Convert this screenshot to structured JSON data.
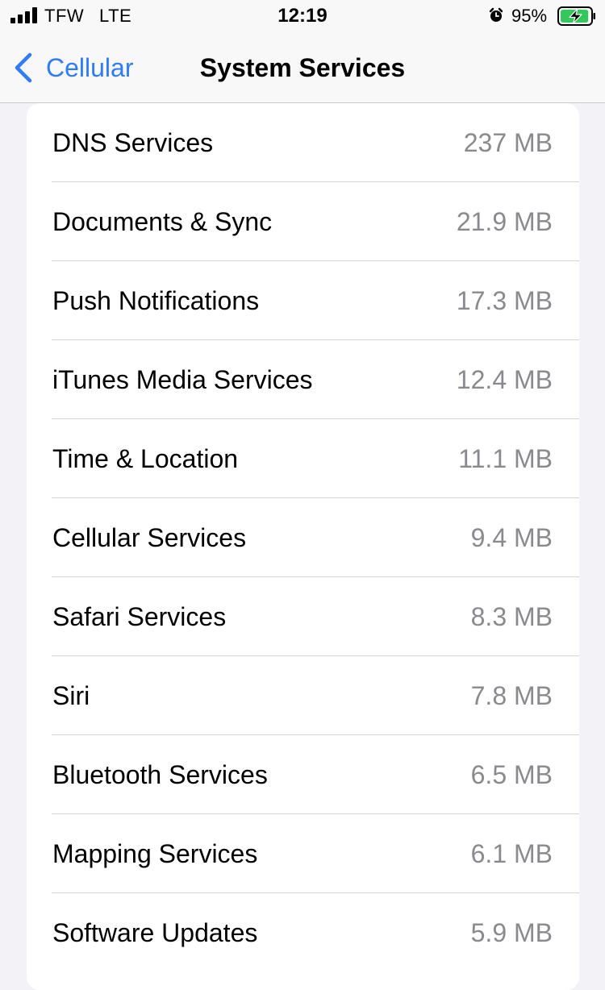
{
  "status_bar": {
    "carrier": "TFW",
    "network": "LTE",
    "time": "12:19",
    "battery_percent": "95%",
    "battery_level": 0.95,
    "icons": [
      "signal-icon",
      "alarm-icon",
      "battery-charging-icon"
    ],
    "accent_battery": "#34c759"
  },
  "nav": {
    "back_label": "Cellular",
    "title": "System Services",
    "accent": "#2f7cf6"
  },
  "services": [
    {
      "label": "DNS Services",
      "value": "237 MB"
    },
    {
      "label": "Documents & Sync",
      "value": "21.9 MB"
    },
    {
      "label": "Push Notifications",
      "value": "17.3 MB"
    },
    {
      "label": "iTunes Media Services",
      "value": "12.4 MB"
    },
    {
      "label": "Time & Location",
      "value": "11.1 MB"
    },
    {
      "label": "Cellular Services",
      "value": "9.4 MB"
    },
    {
      "label": "Safari Services",
      "value": "8.3 MB"
    },
    {
      "label": "Siri",
      "value": "7.8 MB"
    },
    {
      "label": "Bluetooth Services",
      "value": "6.5 MB"
    },
    {
      "label": "Mapping Services",
      "value": "6.1 MB"
    },
    {
      "label": "Software Updates",
      "value": "5.9 MB"
    }
  ]
}
